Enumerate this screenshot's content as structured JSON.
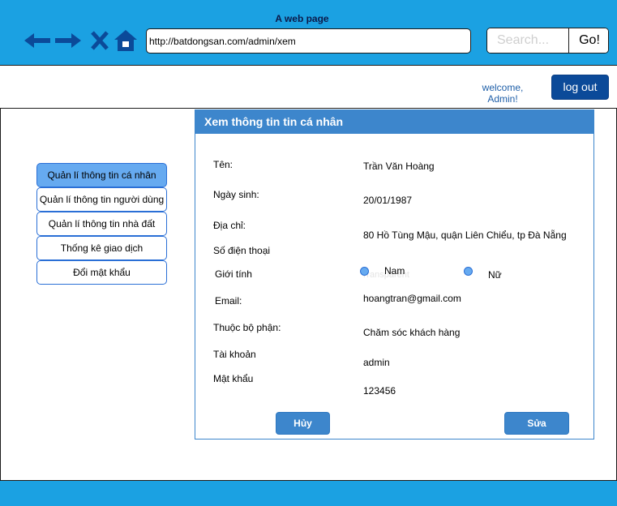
{
  "browser": {
    "title": "A web page",
    "url": "http://batdongsan.com/admin/xem",
    "search_placeholder": "Search...",
    "go_label": "Go!",
    "icons": [
      "back-arrow-icon",
      "forward-arrow-icon",
      "stop-icon",
      "home-icon"
    ]
  },
  "header": {
    "welcome_line1": "welcome,",
    "welcome_line2": "Admin!",
    "logout_label": "log out"
  },
  "sidebar": {
    "items": [
      {
        "label": "Quản lí thông tin cá nhân",
        "active": true
      },
      {
        "label": "Quản lí thông tin người dùng",
        "active": false
      },
      {
        "label": "Quản lí thông tin nhà đất",
        "active": false
      },
      {
        "label": "Thống kê giao dịch",
        "active": false
      },
      {
        "label": "Đổi mật khẩu",
        "active": false
      }
    ]
  },
  "panel": {
    "title": "Xem thông tin tin cá nhân",
    "fields": {
      "name_label": "Tên:",
      "name_value": "Trần Văn Hoàng",
      "dob_label": "Ngày sinh:",
      "dob_value": "20/01/1987",
      "address_label": "Địa chỉ:",
      "address_value": "80 Hồ Tùng Mậu, quận Liên Chiểu, tp Đà Nẵng",
      "phone_label": "Số điện thoại",
      "gender_label": "Giới tính",
      "gender_male": "Nam",
      "gender_female": "Nữ",
      "gender_ghost_text": "Transparent",
      "email_label": "Email:",
      "email_value": "hoangtran@gmail.com",
      "department_label": "Thuộc bộ phận:",
      "department_value": "Chăm sóc khách hàng",
      "account_label": "Tài khoản",
      "account_value": "admin",
      "password_label": "Mật khẩu",
      "password_value": "123456"
    },
    "cancel_label": "Hủy",
    "edit_label": "Sửa"
  },
  "colors": {
    "chrome_blue": "#1ba1e2",
    "panel_header": "#3d86cc",
    "logout_bg": "#0b4a99",
    "sidebar_active": "#66aaf0"
  }
}
